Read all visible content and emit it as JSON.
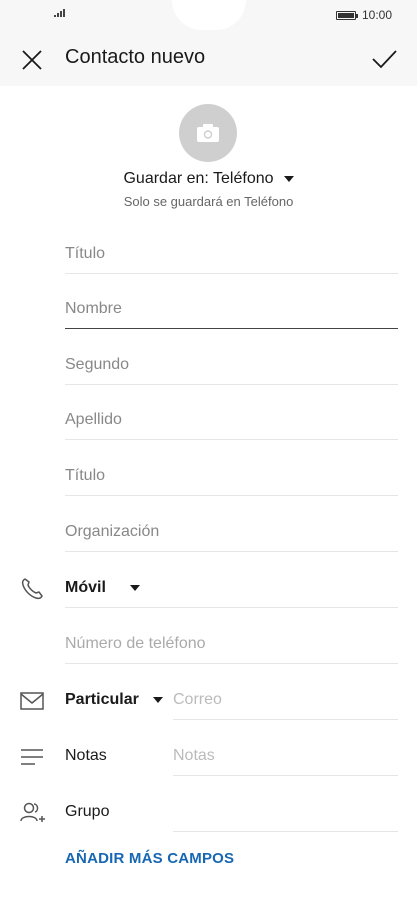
{
  "status_bar": {
    "time": "10:00"
  },
  "header": {
    "title": "Contacto nuevo"
  },
  "save": {
    "label": "Guardar en: Teléfono",
    "subtitle": "Solo se guardará en Teléfono"
  },
  "fields": {
    "prefix_title": "Título",
    "first_name": "Nombre",
    "middle_name": "Segundo",
    "last_name": "Apellido",
    "suffix_title": "Título",
    "organization": "Organización"
  },
  "phone": {
    "type_label": "Móvil",
    "placeholder": "Número de teléfono"
  },
  "email": {
    "type_label": "Particular",
    "placeholder": "Correo"
  },
  "notes": {
    "label": "Notas",
    "placeholder": "Notas"
  },
  "group": {
    "label": "Grupo"
  },
  "actions": {
    "add_more": "AÑADIR MÁS CAMPOS"
  },
  "colors": {
    "accent": "#1767b3",
    "photo_bg": "#cfcfcf"
  },
  "icons": [
    "close-icon",
    "check-icon",
    "camera-icon",
    "phone-icon",
    "mail-icon",
    "notes-icon",
    "group-icon"
  ]
}
